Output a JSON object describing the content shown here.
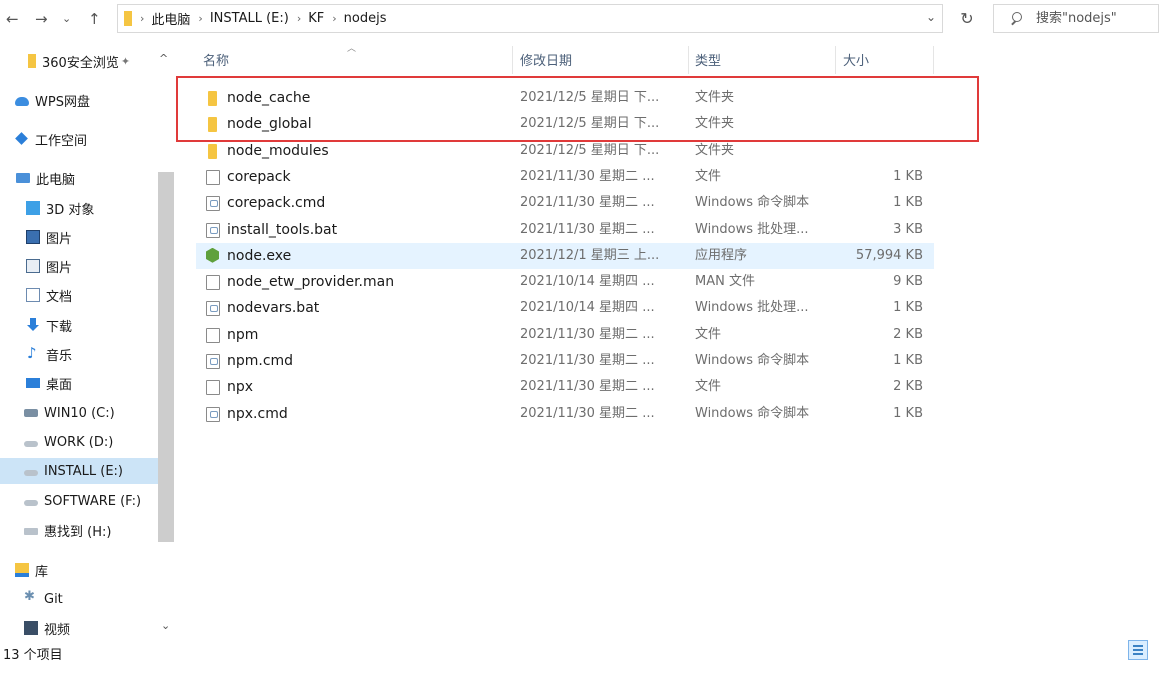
{
  "nav": {
    "back_icon": "arrow-left-icon",
    "forward_icon": "arrow-right-icon",
    "history_icon": "chevron-down-icon",
    "up_icon": "arrow-up-icon"
  },
  "address": {
    "crumbs": [
      "此电脑",
      "INSTALL (E:)",
      "KF",
      "nodejs"
    ]
  },
  "search": {
    "placeholder": "搜索\"nodejs\""
  },
  "sidebar": {
    "items": [
      {
        "label": "360安全浏览",
        "icon": "folder-icon",
        "pinned": true
      },
      {
        "label": "WPS网盘",
        "icon": "cloud-icon"
      },
      {
        "label": "工作空间",
        "icon": "diamond-icon"
      },
      {
        "label": "此电脑",
        "icon": "computer-icon"
      },
      {
        "label": "3D 对象",
        "icon": "cube-icon"
      },
      {
        "label": "图片",
        "icon": "picture-icon"
      },
      {
        "label": "图片",
        "icon": "picture-icon"
      },
      {
        "label": "文档",
        "icon": "document-icon"
      },
      {
        "label": "下载",
        "icon": "download-icon"
      },
      {
        "label": "音乐",
        "icon": "music-icon"
      },
      {
        "label": "桌面",
        "icon": "desktop-icon"
      },
      {
        "label": "WIN10 (C:)",
        "icon": "system-drive-icon"
      },
      {
        "label": "WORK (D:)",
        "icon": "drive-icon"
      },
      {
        "label": "INSTALL (E:)",
        "icon": "drive-icon",
        "selected": true
      },
      {
        "label": "SOFTWARE (F:)",
        "icon": "drive-icon"
      },
      {
        "label": "惠找到 (H:)",
        "icon": "usb-drive-icon"
      },
      {
        "label": "库",
        "icon": "library-icon"
      },
      {
        "label": "Git",
        "icon": "git-icon"
      },
      {
        "label": "视频",
        "icon": "video-icon"
      }
    ]
  },
  "columns": {
    "name": "名称",
    "date": "修改日期",
    "type": "类型",
    "size": "大小"
  },
  "files": [
    {
      "name": "node_cache",
      "date": "2021/12/5 星期日 下...",
      "type": "文件夹",
      "size": "",
      "icon": "folder-icon"
    },
    {
      "name": "node_global",
      "date": "2021/12/5 星期日 下...",
      "type": "文件夹",
      "size": "",
      "icon": "folder-icon"
    },
    {
      "name": "node_modules",
      "date": "2021/12/5 星期日 下...",
      "type": "文件夹",
      "size": "",
      "icon": "folder-icon"
    },
    {
      "name": "corepack",
      "date": "2021/11/30 星期二 ...",
      "type": "文件",
      "size": "1 KB",
      "icon": "file-icon"
    },
    {
      "name": "corepack.cmd",
      "date": "2021/11/30 星期二 ...",
      "type": "Windows 命令脚本",
      "size": "1 KB",
      "icon": "script-icon"
    },
    {
      "name": "install_tools.bat",
      "date": "2021/11/30 星期二 ...",
      "type": "Windows 批处理...",
      "size": "3 KB",
      "icon": "script-icon"
    },
    {
      "name": "node.exe",
      "date": "2021/12/1 星期三 上...",
      "type": "应用程序",
      "size": "57,994 KB",
      "icon": "nodejs-icon",
      "highlighted": true
    },
    {
      "name": "node_etw_provider.man",
      "date": "2021/10/14 星期四 ...",
      "type": "MAN 文件",
      "size": "9 KB",
      "icon": "file-icon"
    },
    {
      "name": "nodevars.bat",
      "date": "2021/10/14 星期四 ...",
      "type": "Windows 批处理...",
      "size": "1 KB",
      "icon": "script-icon"
    },
    {
      "name": "npm",
      "date": "2021/11/30 星期二 ...",
      "type": "文件",
      "size": "2 KB",
      "icon": "file-icon"
    },
    {
      "name": "npm.cmd",
      "date": "2021/11/30 星期二 ...",
      "type": "Windows 命令脚本",
      "size": "1 KB",
      "icon": "script-icon"
    },
    {
      "name": "npx",
      "date": "2021/11/30 星期二 ...",
      "type": "文件",
      "size": "2 KB",
      "icon": "file-icon"
    },
    {
      "name": "npx.cmd",
      "date": "2021/11/30 星期二 ...",
      "type": "Windows 命令脚本",
      "size": "1 KB",
      "icon": "script-icon"
    }
  ],
  "status": {
    "item_count": "13 个项目"
  },
  "colors": {
    "selection": "#cce4f7",
    "hover": "#e5f3ff",
    "annotation_box": "#e03a3a",
    "folder": "#f5c542"
  }
}
